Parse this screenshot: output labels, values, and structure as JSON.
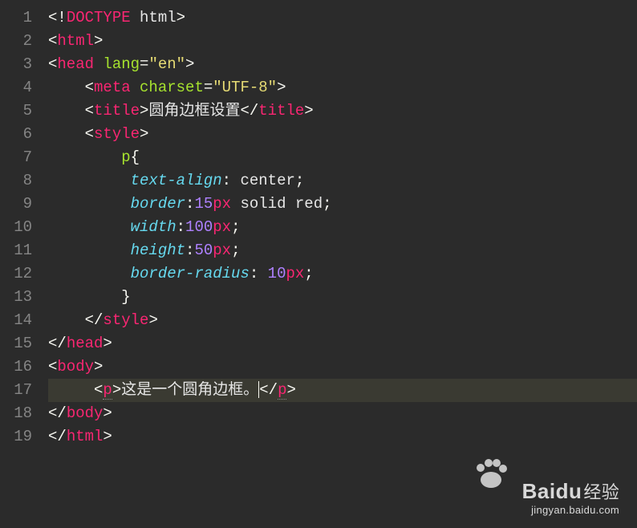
{
  "lineNumbers": [
    "1",
    "2",
    "3",
    "4",
    "5",
    "6",
    "7",
    "8",
    "9",
    "10",
    "11",
    "12",
    "13",
    "14",
    "15",
    "16",
    "17",
    "18",
    "19"
  ],
  "code": {
    "doctype": "DOCTYPE",
    "doctype_name": "html",
    "tags": {
      "html": "html",
      "head": "head",
      "meta": "meta",
      "title": "title",
      "style": "style",
      "body": "body",
      "p": "p"
    },
    "attrs": {
      "lang": "lang",
      "charset": "charset"
    },
    "values": {
      "lang_en": "\"en\"",
      "charset_utf8": "\"UTF-8\""
    },
    "title_text": "圆角边框设置",
    "css": {
      "selector_p": "p",
      "prop_text_align": "text-align",
      "val_center": "center",
      "prop_border": "border",
      "val_border_num": "15",
      "val_border_unit": "px",
      "val_border_rest": " solid red",
      "prop_width": "width",
      "val_width_num": "100",
      "val_width_unit": "px",
      "prop_height": "height",
      "val_height_num": "50",
      "val_height_unit": "px",
      "prop_border_radius": "border-radius",
      "val_br_num": "10",
      "val_br_unit": "px"
    },
    "p_text": "这是一个圆角边框。"
  },
  "watermark": {
    "brand": "Baidu",
    "cn": "经验",
    "url": "jingyan.baidu.com"
  }
}
